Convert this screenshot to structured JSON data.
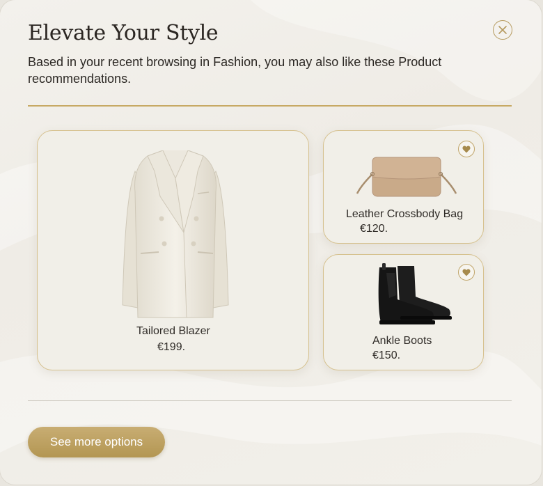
{
  "dialog": {
    "title": "Elevate Your Style",
    "subtitle": "Based in your recent browsing in Fashion, you may also like these Product recommendations.",
    "close_icon": "close-icon"
  },
  "products": [
    {
      "name": "Tailored Blazer",
      "price": "€199.",
      "icon": "blazer-image"
    },
    {
      "name": "Leather Crossbody Bag",
      "price": "€120.",
      "icon": "crossbody-bag-image",
      "favorite_icon": "heart-icon"
    },
    {
      "name": "Ankle Boots",
      "price": "€150.",
      "icon": "ankle-boots-image",
      "favorite_icon": "heart-icon"
    }
  ],
  "footer": {
    "see_more_label": "See more options"
  },
  "colors": {
    "accent_gold": "#c7a964",
    "button_gold": "#b39652",
    "card_bg": "#f1efe8",
    "text_dark": "#2b2622"
  }
}
